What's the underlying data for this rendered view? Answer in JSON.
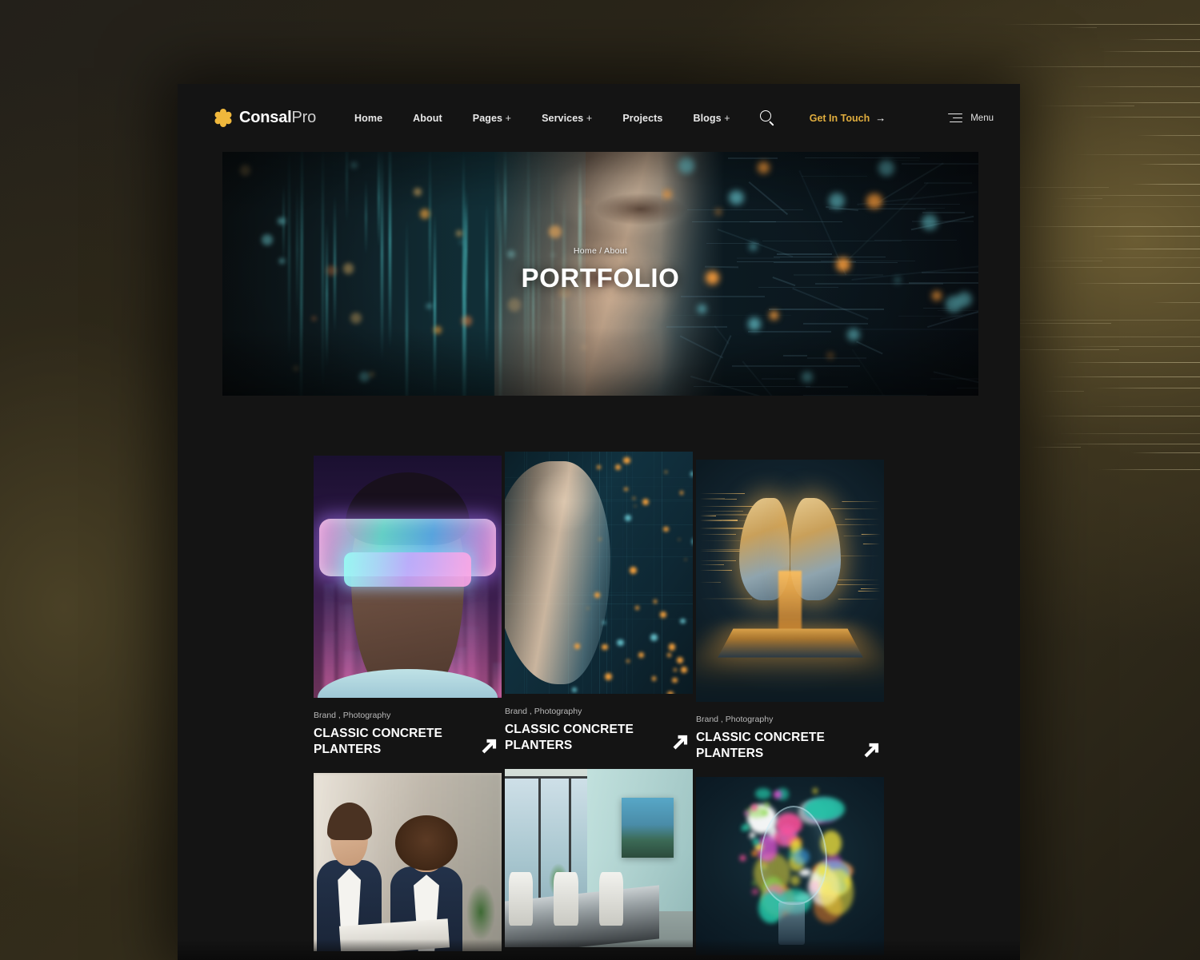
{
  "theme": {
    "accent_gold": "#e0ad3e",
    "logo_gold": "#f0b83c",
    "page_bg": "#141414",
    "text_primary": "#ffffff",
    "text_muted": "#b9b9b9"
  },
  "header": {
    "logo": {
      "icon": "asterisk-flower-icon",
      "name_bold": "Consal",
      "name_light": "Pro"
    },
    "nav": [
      {
        "label": "Home",
        "suffix": ""
      },
      {
        "label": "About",
        "suffix": ""
      },
      {
        "label": "Pages",
        "suffix": " +"
      },
      {
        "label": "Services",
        "suffix": " +"
      },
      {
        "label": "Projects",
        "suffix": ""
      },
      {
        "label": "Blogs",
        "suffix": " +"
      }
    ],
    "search_icon": "search-icon",
    "cta": {
      "label": "Get In Touch",
      "arrow": "→"
    },
    "menu": {
      "label": "Menu",
      "icon": "hamburger-icon"
    }
  },
  "hero": {
    "breadcrumb": "Home / About",
    "title": "PORTFOLIO"
  },
  "portfolio": {
    "rows": [
      {
        "cards": [
          {
            "image": "vr-goggles-portrait",
            "tags": "Brand , Photography",
            "title": "CLASSIC CONCRETE PLANTERS",
            "arrow_icon": "arrow-up-right-icon"
          },
          {
            "image": "cyber-face-profile",
            "tags": "Brand , Photography",
            "title": "CLASSIC CONCRETE PLANTERS",
            "arrow_icon": "arrow-up-right-icon"
          },
          {
            "image": "glowing-brain-chip",
            "tags": "Brand , Photography",
            "title": "CLASSIC CONCRETE PLANTERS",
            "arrow_icon": "arrow-up-right-icon"
          }
        ]
      },
      {
        "cards": [
          {
            "image": "business-pair-reviewing-documents"
          },
          {
            "image": "modern-meeting-room"
          },
          {
            "image": "paint-splash-lightbulb"
          }
        ]
      }
    ]
  }
}
